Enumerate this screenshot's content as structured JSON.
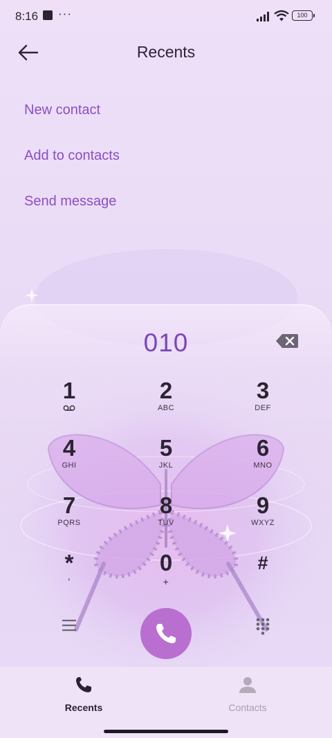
{
  "status": {
    "time": "8:16",
    "dots": "···",
    "battery": "100"
  },
  "header": {
    "title": "Recents"
  },
  "actions": [
    "New contact",
    "Add to contacts",
    "Send message"
  ],
  "dialer": {
    "number": "010",
    "keys": [
      {
        "digit": "1",
        "letters": ""
      },
      {
        "digit": "2",
        "letters": "ABC"
      },
      {
        "digit": "3",
        "letters": "DEF"
      },
      {
        "digit": "4",
        "letters": "GHI"
      },
      {
        "digit": "5",
        "letters": "JKL"
      },
      {
        "digit": "6",
        "letters": "MNO"
      },
      {
        "digit": "7",
        "letters": "PQRS"
      },
      {
        "digit": "8",
        "letters": "TUV"
      },
      {
        "digit": "9",
        "letters": "WXYZ"
      },
      {
        "digit": "*",
        "letters": ","
      },
      {
        "digit": "0",
        "letters": "+"
      },
      {
        "digit": "#",
        "letters": ""
      }
    ]
  },
  "nav": {
    "recents": "Recents",
    "contacts": "Contacts"
  },
  "colors": {
    "accent": "#8a4fc4",
    "call": "#b86fd0",
    "number": "#7a46b8"
  }
}
